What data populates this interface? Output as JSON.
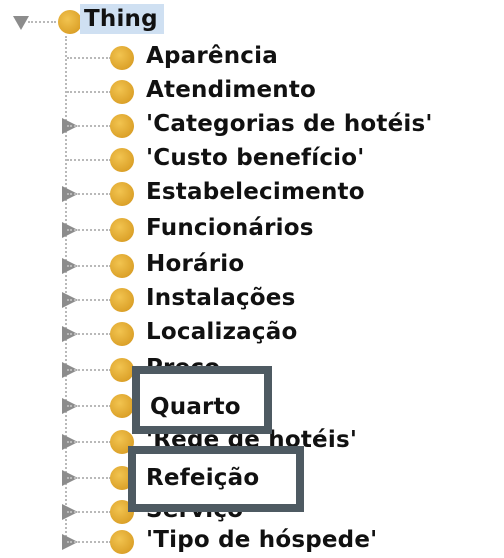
{
  "tree": {
    "root": {
      "label": "Thing",
      "expanded": true
    },
    "items": [
      {
        "label": "Aparência",
        "has_children": false
      },
      {
        "label": "Atendimento",
        "has_children": false
      },
      {
        "label": "'Categorias de hotéis'",
        "has_children": true
      },
      {
        "label": "'Custo benefício'",
        "has_children": false
      },
      {
        "label": "Estabelecimento",
        "has_children": true
      },
      {
        "label": "Funcionários",
        "has_children": true
      },
      {
        "label": "Horário",
        "has_children": true
      },
      {
        "label": "Instalações",
        "has_children": true
      },
      {
        "label": "Localização",
        "has_children": true
      },
      {
        "label": "Preço",
        "has_children": true
      },
      {
        "label": "Quarto",
        "has_children": true
      },
      {
        "label": "'Rede de hotéis'",
        "has_children": true
      },
      {
        "label": "Refeição",
        "has_children": true
      },
      {
        "label": "Serviço",
        "has_children": true
      },
      {
        "label": "'Tipo de hóspede'",
        "has_children": true
      }
    ],
    "highlighted": [
      "Quarto",
      "Refeição"
    ]
  },
  "colors": {
    "class_dot": "#dca22a",
    "root_selection": "#cfe0f2",
    "highlight_box": "#4e5a62"
  },
  "icons": {
    "expanded": "triangle-down-icon",
    "collapsed": "triangle-right-icon",
    "class": "class-circle-icon"
  }
}
